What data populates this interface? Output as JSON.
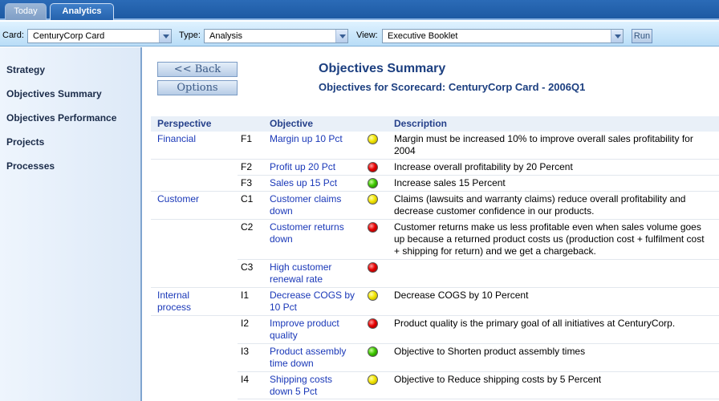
{
  "tabs": [
    {
      "label": "Today"
    },
    {
      "label": "Analytics"
    }
  ],
  "toolbar": {
    "card_label": "Card:",
    "card_value": "CenturyCorp Card",
    "type_label": "Type:",
    "type_value": "Analysis",
    "view_label": "View:",
    "view_value": "Executive Booklet",
    "run_label": "Run"
  },
  "sidebar": {
    "items": [
      {
        "label": "Strategy"
      },
      {
        "label": "Objectives Summary"
      },
      {
        "label": "Objectives Performance"
      },
      {
        "label": "Projects"
      },
      {
        "label": "Processes"
      }
    ]
  },
  "main": {
    "back_label": "<< Back",
    "options_label": "Options",
    "title": "Objectives Summary",
    "subtitle": "Objectives for Scorecard: CenturyCorp Card - 2006Q1",
    "headers": {
      "perspective": "Perspective",
      "objective": "Objective",
      "description": "Description"
    },
    "rows": [
      {
        "perspective": "Financial",
        "code": "F1",
        "objective": "Margin up 10 Pct",
        "status": "yellow",
        "description": "Margin must be increased 10% to improve overall sales profitability for 2004"
      },
      {
        "perspective": "",
        "code": "F2",
        "objective": "Profit up 20 Pct",
        "status": "red",
        "description": "Increase overall profitability by 20 Percent"
      },
      {
        "perspective": "",
        "code": "F3",
        "objective": "Sales up 15 Pct",
        "status": "green",
        "description": "Increase sales 15 Percent"
      },
      {
        "perspective": "Customer",
        "code": "C1",
        "objective": "Customer claims down",
        "status": "yellow",
        "description": "Claims (lawsuits and warranty claims) reduce overall profitability and decrease customer confidence in our products."
      },
      {
        "perspective": "",
        "code": "C2",
        "objective": "Customer returns down",
        "status": "red",
        "description": "Customer returns make us less profitable even when sales volume goes up because a returned product costs us (production cost + fulfilment cost + shipping for return) and we get a chargeback."
      },
      {
        "perspective": "",
        "code": "C3",
        "objective": "High customer renewal rate",
        "status": "red",
        "description": ""
      },
      {
        "perspective": "Internal process",
        "code": "I1",
        "objective": "Decrease COGS by 10 Pct",
        "status": "yellow",
        "description": "Decrease COGS by 10 Percent"
      },
      {
        "perspective": "",
        "code": "I2",
        "objective": "Improve product quality",
        "status": "red",
        "description": "Product quality is the primary goal of all initiatives at CenturyCorp."
      },
      {
        "perspective": "",
        "code": "I3",
        "objective": "Product assembly time down",
        "status": "green",
        "description": "Objective to Shorten product assembly times"
      },
      {
        "perspective": "",
        "code": "I4",
        "objective": "Shipping costs down 5 Pct",
        "status": "yellow",
        "description": "Objective to Reduce shipping costs by 5 Percent"
      }
    ]
  }
}
